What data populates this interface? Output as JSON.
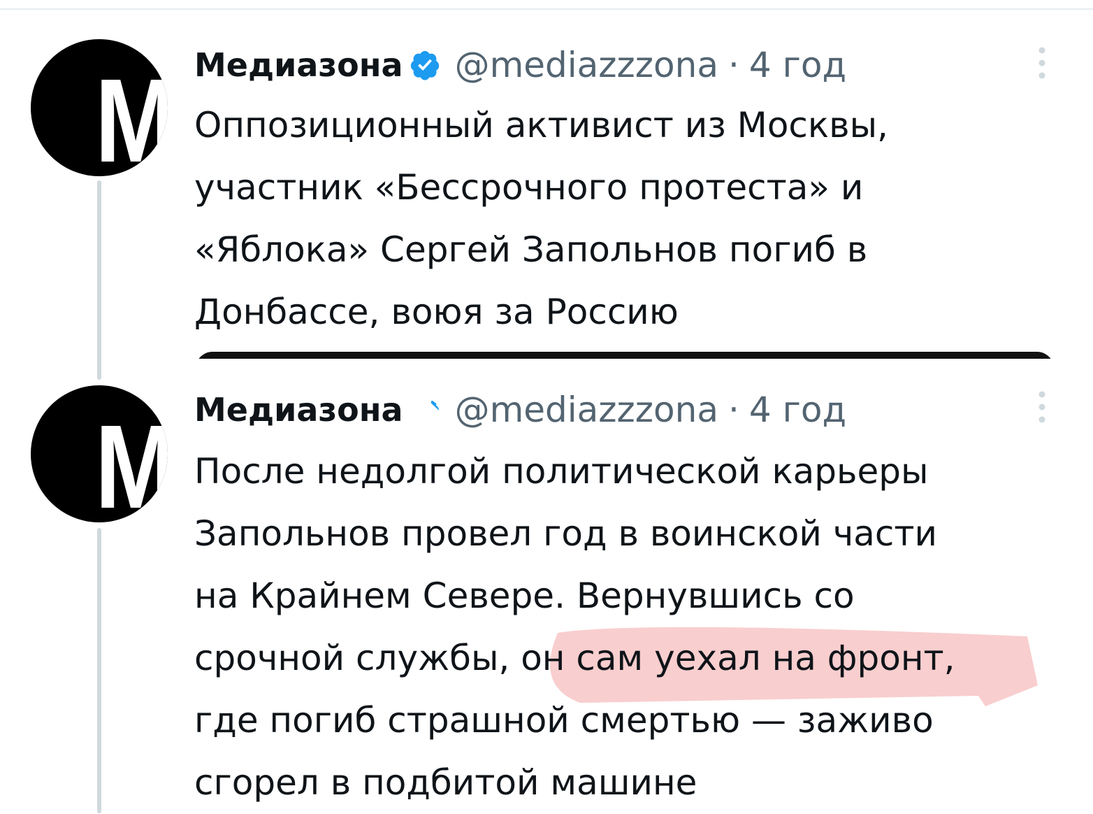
{
  "tweets": [
    {
      "avatar_letter": "M",
      "display_name": "Медиазона",
      "handle": "@mediazzzona",
      "separator": "·",
      "time": "4 год",
      "text_lines": [
        "Оппозиционный активист из Москвы,",
        "участник «Бессрочного протеста» и",
        "«Яблока» Сергей Запольнов погиб в",
        "Донбассе, воюя за Россию"
      ]
    },
    {
      "avatar_letter": "M",
      "display_name": "Медиазона",
      "handle": "@mediazzzona",
      "separator": "·",
      "time": "4 год",
      "text_lines": [
        "После недолгой политической карьеры",
        "Запольнов провел год в воинской части",
        "на Крайнем Севере. Вернувшись со",
        "срочной службы, он сам уехал на фронт,",
        "где погиб страшной смертью — заживо",
        "сгорел в подбитой машине"
      ]
    }
  ],
  "icons": {
    "verified": "verified-badge-icon",
    "more": "more-vertical-icon"
  },
  "colors": {
    "verified_blue": "#1d9bf0",
    "muted_text": "#536471",
    "highlight": "#f4a6a6",
    "thread_line": "#cfd9de"
  }
}
